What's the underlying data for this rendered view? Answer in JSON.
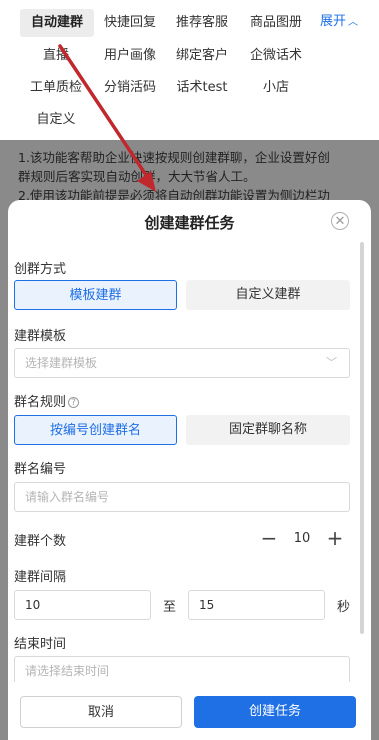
{
  "tag_menu": {
    "tags": [
      "自动建群",
      "快捷回复",
      "推荐客服",
      "商品图册",
      "直播",
      "用户画像",
      "绑定客户",
      "企微话术",
      "工单质检",
      "分销活码",
      "话术test",
      "小店",
      "自定义"
    ],
    "expand_label": "展开"
  },
  "background_notice": {
    "line1": "1.该功能客帮助企业快速按规则创建群聊，企业设置好创",
    "line2": "群规则后客实现自动创群，大大节省人工。",
    "line3": "2.使用该功能前提是必须将自动创群功能设置为侧边栏功"
  },
  "dialog": {
    "title": "创建建群任务",
    "mode_label": "创群方式",
    "mode_options": [
      "模板建群",
      "自定义建群"
    ],
    "template_label": "建群模板",
    "template_placeholder": "选择建群模板",
    "name_rule_label": "群名规则",
    "name_rule_options": [
      "按编号创建群名",
      "固定群聊名称"
    ],
    "name_number_label": "群名编号",
    "name_number_placeholder": "请输入群名编号",
    "count_label": "建群个数",
    "count_value": "10",
    "interval_label": "建群间隔",
    "interval_from": "10",
    "interval_sep": "至",
    "interval_to": "15",
    "interval_unit": "秒",
    "end_time_label": "结束时间",
    "end_time_placeholder": "请选择结束时间",
    "cancel_label": "取消",
    "submit_label": "创建任务"
  },
  "colors": {
    "accent": "#1f6fe5",
    "annotation_arrow": "#c0282d"
  },
  "icons": {
    "close": "close-circle-icon",
    "help": "question-circle-icon",
    "chevron": "chevron-down-icon"
  }
}
